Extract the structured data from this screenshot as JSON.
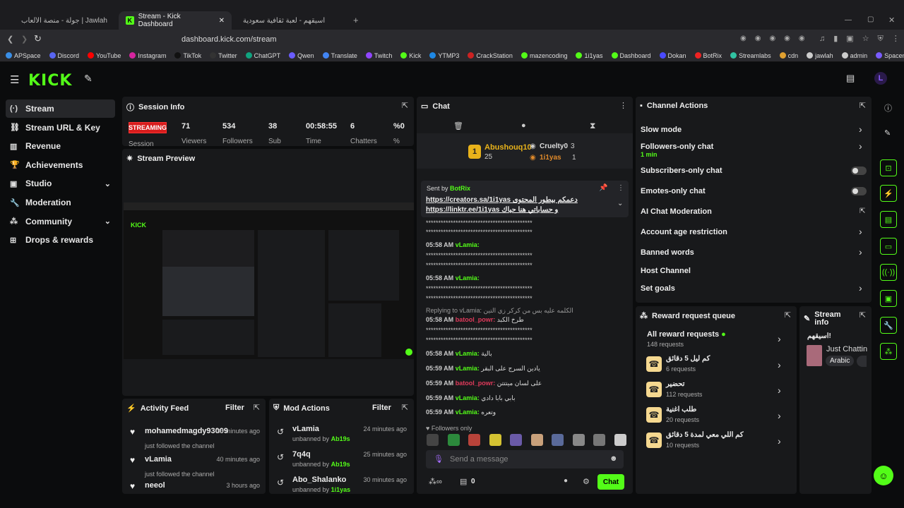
{
  "browser": {
    "tabs": [
      {
        "title": "Jawlah | جولة - منصة الألعاب التفاعلية"
      },
      {
        "title": "Stream - Kick Dashboard"
      },
      {
        "title": "اسيقهم - لعبة ثقافية سعودية"
      }
    ],
    "url": "dashboard.kick.com/stream",
    "bookmarks": [
      "APSpace",
      "Discord",
      "YouTube",
      "Instagram",
      "TikTok",
      "Twitter",
      "ChatGPT",
      "Qwen",
      "Translate",
      "Twitch",
      "Kick",
      "YTMP3",
      "CrackStation",
      "mazencoding",
      "1i1yas",
      "Dashboard",
      "Dokan",
      "BotRix",
      "Streamlabs",
      "cdn",
      "jawlah",
      "admin",
      "Spacemail"
    ]
  },
  "logo": "KICK",
  "sidebar": {
    "items": [
      {
        "label": "Stream",
        "icon": "stream-icon"
      },
      {
        "label": "Stream URL & Key",
        "icon": "link-icon"
      },
      {
        "label": "Revenue",
        "icon": "revenue-icon"
      },
      {
        "label": "Achievements",
        "icon": "trophy-icon"
      },
      {
        "label": "Studio",
        "icon": "studio-icon"
      },
      {
        "label": "Moderation",
        "icon": "wrench-icon"
      },
      {
        "label": "Community",
        "icon": "community-icon"
      },
      {
        "label": "Drops & rewards",
        "icon": "gift-icon"
      }
    ]
  },
  "session": {
    "title": "Session Info",
    "status": "STREAMING",
    "status_label": "Session",
    "stats": [
      {
        "value": "71",
        "label": "Viewers"
      },
      {
        "value": "534",
        "label": "Followers"
      },
      {
        "value": "38",
        "label": "Sub"
      },
      {
        "value": "00:58:55",
        "label": "Time"
      },
      {
        "value": "6",
        "label": "Chatters"
      },
      {
        "value": "%0",
        "label": "%"
      }
    ]
  },
  "preview": {
    "title": "Stream Preview"
  },
  "activity": {
    "title": "Activity Feed",
    "filter": "Filter",
    "items": [
      {
        "name": "mohamedmagdy93009",
        "sub": "just followed the channel",
        "time": "36 minutes ago"
      },
      {
        "name": "vLamia",
        "sub": "just followed the channel",
        "time": "40 minutes ago"
      },
      {
        "name": "neeol",
        "sub": "",
        "time": "3 hours ago"
      }
    ]
  },
  "mod": {
    "title": "Mod Actions",
    "filter": "Filter",
    "by": "unbanned by",
    "items": [
      {
        "name": "vLamia",
        "mod": "Ab19s",
        "time": "24 minutes ago"
      },
      {
        "name": "7q4q",
        "mod": "Ab19s",
        "time": "25 minutes ago"
      },
      {
        "name": "Abo_Shalanko",
        "mod": "1i1yas",
        "time": "30 minutes ago"
      }
    ]
  },
  "chat": {
    "title": "Chat",
    "top": [
      {
        "name": "Abushouq10",
        "count": "25"
      },
      {
        "name": "Cruelty0",
        "count": "3"
      },
      {
        "name": "1i1yas",
        "count": "1"
      }
    ],
    "pinned_by": "Sent by",
    "pinned_user": "BotRix",
    "pinned_line1": "https://creators.sa/1i1yas دعمكم بيطور المحتوى",
    "pinned_line2": "https://linktr.ee/1i1yas و حساباتي هنا حياك",
    "stars": "*******************************************",
    "messages": [
      {
        "time": "05:58 AM",
        "user": "vLamia:",
        "text": ""
      },
      {
        "time": "05:58 AM",
        "user": "vLamia:",
        "text": ""
      },
      {
        "time": "05:58 AM",
        "user": "batool_powr:",
        "text": "طرخ الكبد"
      },
      {
        "time": "05:58 AM",
        "user": "vLamia:",
        "text": "بالية"
      },
      {
        "time": "05:59 AM",
        "user": "vLamia:",
        "text": "يادين السرج على البقر"
      },
      {
        "time": "05:59 AM",
        "user": "batool_powr:",
        "text": "على لسان ميتتتن"
      },
      {
        "time": "05:59 AM",
        "user": "vLamia:",
        "text": "بابي بابا دادي"
      },
      {
        "time": "05:59 AM",
        "user": "vLamia:",
        "text": "وتعره"
      }
    ],
    "reply": "Replying to vLamia: الكلمه عليه بس من كركر زي التين",
    "followers_only": "Followers only",
    "placeholder": "Send a message",
    "count": "0",
    "send": "Chat"
  },
  "actions": {
    "title": "Channel Actions",
    "items": [
      {
        "label": "Slow mode"
      },
      {
        "label": "Followers-only chat",
        "sub": "1 min"
      },
      {
        "label": "Subscribers-only chat"
      },
      {
        "label": "Emotes-only chat"
      },
      {
        "label": "AI Chat Moderation"
      },
      {
        "label": "Account age restriction"
      },
      {
        "label": "Banned words"
      },
      {
        "label": "Host Channel"
      },
      {
        "label": "Set goals"
      }
    ]
  },
  "rewards": {
    "title": "Reward request queue",
    "all": "All reward requests",
    "all_sub": "148 requests",
    "items": [
      {
        "title": "كم ليل 5 دقائق",
        "sub": "6 requests"
      },
      {
        "title": "تحضير",
        "sub": "112 requests"
      },
      {
        "title": "طلب اغنية",
        "sub": "20 requests"
      },
      {
        "title": "كم اللي معي لمدة 5 دقائق",
        "sub": "10 requests"
      }
    ]
  },
  "streaminfo": {
    "title": "Stream info",
    "name": "اسيقهم!",
    "category": "Just Chatting",
    "tag": "Arabic"
  },
  "colors": {
    "accent": "#53fc18",
    "live": "#d81d1d"
  }
}
